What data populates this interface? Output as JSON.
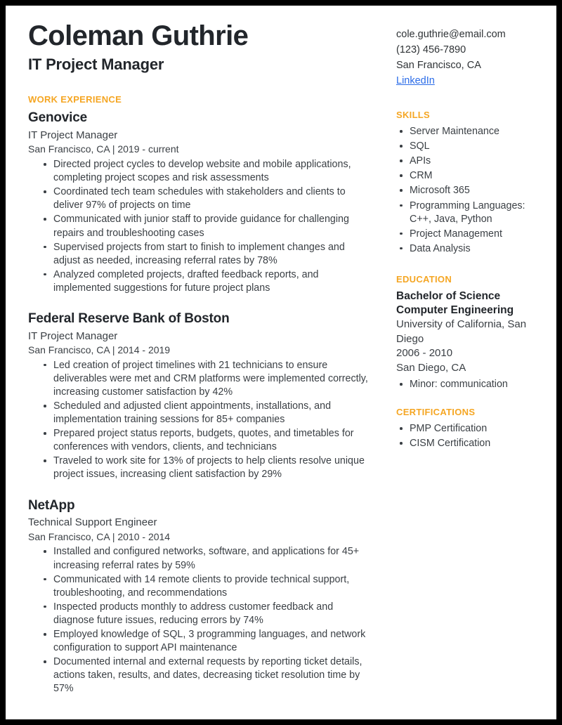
{
  "header": {
    "name": "Coleman Guthrie",
    "headline": "IT Project Manager"
  },
  "contact": {
    "email": "cole.guthrie@email.com",
    "phone": "(123) 456-7890",
    "location": "San Francisco, CA",
    "link_label": "LinkedIn",
    "link_color": "#2b6ce8"
  },
  "theme": {
    "accent": "#f5a623",
    "text_dark": "#22262b",
    "text_body": "#3a3f44",
    "page_border": "#000000"
  },
  "sections": {
    "work_experience_heading": "WORK EXPERIENCE",
    "skills_heading": "SKILLS",
    "education_heading": "EDUCATION",
    "certifications_heading": "CERTIFICATIONS"
  },
  "jobs": [
    {
      "company": "Genovice",
      "title": "IT Project Manager",
      "meta": "San Francisco, CA  |  2019 - current",
      "bullets": [
        "Directed project cycles to develop website and mobile applications, completing project scopes and risk assessments",
        "Coordinated tech team schedules with stakeholders and clients to deliver 97% of projects on time",
        "Communicated with junior staff to provide guidance for challenging repairs and troubleshooting cases",
        "Supervised projects from start to finish to implement changes and adjust as needed, increasing referral rates by 78%",
        "Analyzed completed projects, drafted feedback reports, and implemented suggestions for future project plans"
      ]
    },
    {
      "company": "Federal Reserve Bank of Boston",
      "title": "IT Project Manager",
      "meta": "San Francisco, CA  |  2014 - 2019",
      "bullets": [
        "Led creation of project timelines with 21 technicians to ensure deliverables were met and CRM platforms were implemented correctly, increasing customer satisfaction by 42%",
        "Scheduled and adjusted client appointments, installations, and implementation training sessions for 85+ companies",
        "Prepared project status reports, budgets, quotes, and timetables for conferences with vendors, clients, and technicians",
        "Traveled to work site for 13% of projects to help clients resolve unique project issues, increasing client satisfaction by 29%"
      ]
    },
    {
      "company": "NetApp",
      "title": "Technical Support Engineer",
      "meta": "San Francisco, CA  |  2010 - 2014",
      "bullets": [
        "Installed and configured networks, software, and applications for 45+ increasing referral rates by 59%",
        "Communicated with 14 remote clients to provide technical support, troubleshooting, and recommendations",
        "Inspected products monthly to address customer feedback and diagnose future issues, reducing errors by 74%",
        "Employed knowledge of SQL, 3 programming languages, and network configuration to support API maintenance",
        "Documented internal and external requests by reporting ticket details, actions taken, results, and dates, decreasing ticket resolution time by 57%"
      ]
    }
  ],
  "skills": [
    "Server Maintenance",
    "SQL",
    "APIs",
    "CRM",
    "Microsoft 365",
    "Programming Languages: C++, Java, Python",
    "Project Management",
    "Data Analysis"
  ],
  "education": {
    "degree_line1": "Bachelor of Science",
    "degree_line2": "Computer Engineering",
    "school": "University of California, San Diego",
    "years": "2006 - 2010",
    "location": "San Diego, CA",
    "notes": [
      "Minor: communication"
    ]
  },
  "certifications": [
    "PMP Certification",
    "CISM Certification"
  ]
}
